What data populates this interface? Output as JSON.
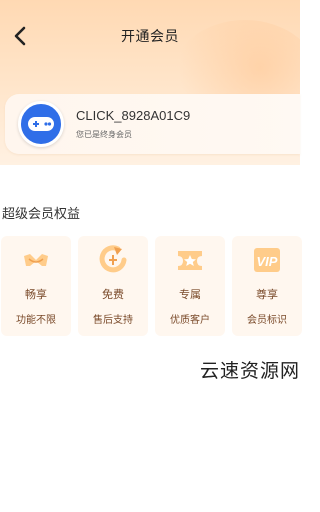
{
  "header": {
    "title": "开通会员",
    "back_icon": "chevron-left-icon"
  },
  "member_card": {
    "username": "CLICK_8928A01C9",
    "status": "您已是终身会员",
    "avatar_icon": "gamepad-icon",
    "avatar_color": "#2f6ee8"
  },
  "benefits": {
    "section_title": "超级会员权益",
    "items": [
      {
        "title": "畅享",
        "desc": "功能不限",
        "icon": "infinity-icon"
      },
      {
        "title": "免费",
        "desc": "售后支持",
        "icon": "refresh-icon"
      },
      {
        "title": "专属",
        "desc": "优质客户",
        "icon": "star-badge-icon"
      },
      {
        "title": "尊享",
        "desc": "会员标识",
        "icon": "vip-icon"
      }
    ]
  },
  "watermark": "云速资源网",
  "colors": {
    "accent": "#f0a050",
    "card_bg": "#fff7ef",
    "benefit_text": "#7a4a2a"
  }
}
